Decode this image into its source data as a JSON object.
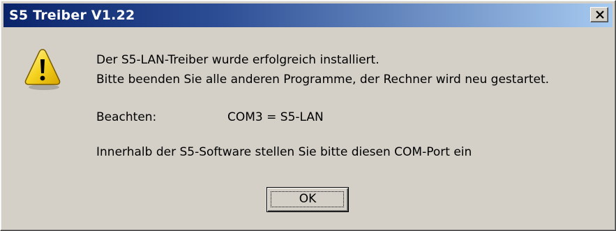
{
  "window": {
    "title": "S5 Treiber V1.22",
    "close_icon": "close-x-icon"
  },
  "message": {
    "icon": "warning-icon",
    "line1": "Der S5-LAN-Treiber wurde erfolgreich installiert.",
    "line2": "Bitte beenden Sie alle anderen Programme, der Rechner  wird neu gestartet.",
    "note_label": "Beachten:",
    "note_value": "COM3 = S5-LAN",
    "line4": "Innerhalb der S5-Software stellen Sie bitte diesen COM-Port ein"
  },
  "buttons": {
    "ok_label": "OK"
  },
  "colors": {
    "titlebar_start": "#0a246a",
    "titlebar_end": "#a6caf0",
    "face": "#d4d0c8",
    "warning_yellow": "#f5d21f"
  }
}
